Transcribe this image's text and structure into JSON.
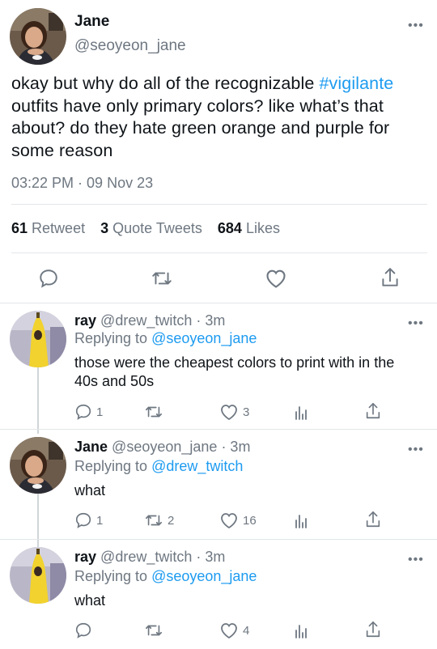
{
  "main_tweet": {
    "name": "Jane",
    "handle": "@seoyeon_jane",
    "text_before": "okay but why do all of the recognizable ",
    "hashtag": "#vigilante",
    "text_after": " outfits have only primary colors? like what’s that about? do they hate green orange and purple for some reason",
    "timestamp": "03:22 PM · 09 Nov 23",
    "retweets": "61",
    "retweets_label": "Retweet",
    "quotes": "3",
    "quotes_label": "Quote Tweets",
    "likes": "684",
    "likes_label": "Likes",
    "more": "•••"
  },
  "replies": [
    {
      "name": "ray",
      "handle": "@drew_twitch",
      "time": "· 3m",
      "replying_prefix": "Replying to",
      "replying_to": "@seoyeon_jane",
      "text": "those were the cheapest colors to print with in the 40s and 50s",
      "reply_count": "1",
      "retweet_count": "",
      "like_count": "3",
      "more": "•••"
    },
    {
      "name": "Jane",
      "handle": "@seoyeon_jane",
      "time": "· 3m",
      "replying_prefix": "Replying to",
      "replying_to": "@drew_twitch",
      "text": "what",
      "reply_count": "1",
      "retweet_count": "2",
      "like_count": "16",
      "more": "•••"
    },
    {
      "name": "ray",
      "handle": "@drew_twitch",
      "time": "· 3m",
      "replying_prefix": "Replying to",
      "replying_to": "@seoyeon_jane",
      "text": "what",
      "reply_count": "",
      "retweet_count": "",
      "like_count": "4",
      "more": "•••"
    }
  ],
  "colors": {
    "accent": "#1d9bf0",
    "muted": "#6e7781",
    "divider": "#e3e6e8",
    "banana_yellow": "#f2d22e"
  },
  "icons": [
    "reply-icon",
    "retweet-icon",
    "like-icon",
    "analytics-icon",
    "share-icon",
    "more-icon"
  ]
}
